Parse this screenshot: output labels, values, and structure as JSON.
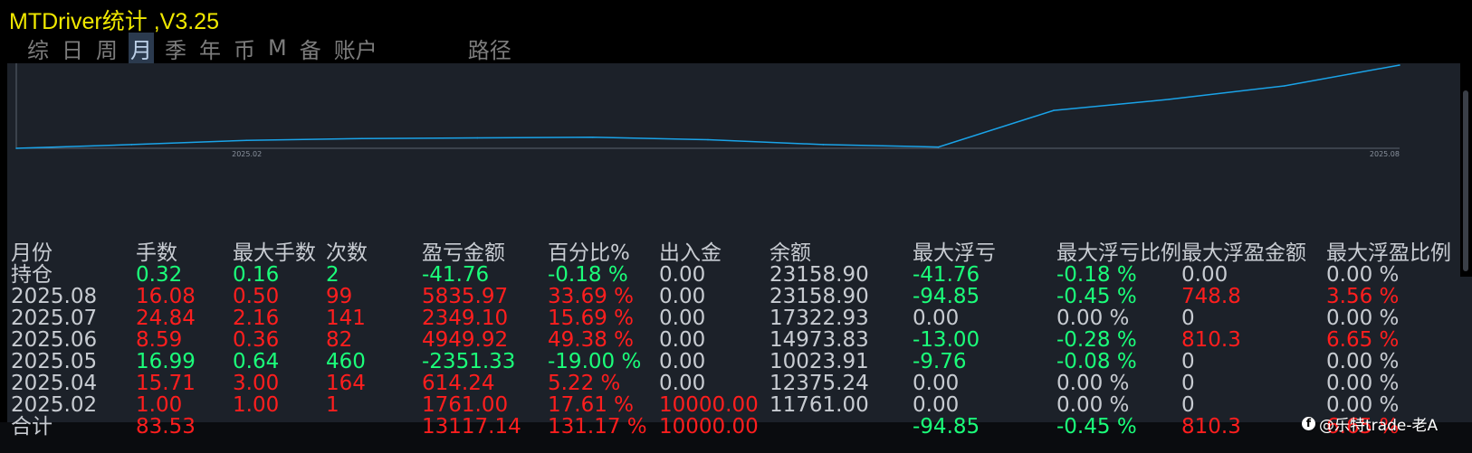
{
  "title": "MTDriver统计 ,V3.25",
  "tabs": [
    {
      "label": "综"
    },
    {
      "label": "日"
    },
    {
      "label": "周"
    },
    {
      "label": "月",
      "active": true
    },
    {
      "label": "季"
    },
    {
      "label": "年"
    },
    {
      "label": "币"
    },
    {
      "label": "M"
    },
    {
      "label": "备"
    },
    {
      "label": "账户"
    },
    {
      "label": "路径"
    }
  ],
  "chart_data": {
    "type": "line",
    "series": [
      {
        "values": [
          1000,
          1300,
          1650,
          1800,
          1850,
          1900,
          1700,
          1300,
          1100,
          4100,
          5000,
          6100,
          7800
        ]
      }
    ],
    "x_tick_labels": [
      "2025.02",
      "2025.08"
    ],
    "color": "#1aa3e8"
  },
  "table": {
    "headers": [
      "月份",
      "手数",
      "最大手数",
      "次数",
      "盈亏金额",
      "百分比%",
      "出入金",
      "余额",
      "最大浮亏",
      "最大浮亏比例",
      "最大浮盈金额",
      "最大浮盈比例"
    ],
    "rows": [
      {
        "cells": [
          "持仓",
          "0.32",
          "0.16",
          "2",
          "-41.76",
          "-0.18 %",
          "0.00",
          "23158.90",
          "-41.76",
          "-0.18 %",
          "0.00",
          "0.00 %"
        ],
        "colors": [
          "w",
          "g",
          "g",
          "g",
          "g",
          "g",
          "w",
          "w",
          "g",
          "g",
          "w",
          "w"
        ]
      },
      {
        "cells": [
          "2025.08",
          "16.08",
          "0.50",
          "99",
          "5835.97",
          "33.69 %",
          "0.00",
          "23158.90",
          "-94.85",
          "-0.45 %",
          "748.8",
          "3.56 %"
        ],
        "colors": [
          "w",
          "r",
          "r",
          "r",
          "r",
          "r",
          "w",
          "w",
          "g",
          "g",
          "r",
          "r"
        ]
      },
      {
        "cells": [
          "2025.07",
          "24.84",
          "2.16",
          "141",
          "2349.10",
          "15.69 %",
          "0.00",
          "17322.93",
          "0.00",
          "0.00 %",
          "0",
          "0.00 %"
        ],
        "colors": [
          "w",
          "r",
          "r",
          "r",
          "r",
          "r",
          "w",
          "w",
          "w",
          "w",
          "w",
          "w"
        ]
      },
      {
        "cells": [
          "2025.06",
          "8.59",
          "0.36",
          "82",
          "4949.92",
          "49.38 %",
          "0.00",
          "14973.83",
          "-13.00",
          "-0.28 %",
          "810.3",
          "6.65 %"
        ],
        "colors": [
          "w",
          "r",
          "r",
          "r",
          "r",
          "r",
          "w",
          "w",
          "g",
          "g",
          "r",
          "r"
        ]
      },
      {
        "cells": [
          "2025.05",
          "16.99",
          "0.64",
          "460",
          "-2351.33",
          "-19.00 %",
          "0.00",
          "10023.91",
          "-9.76",
          "-0.08 %",
          "0",
          "0.00 %"
        ],
        "colors": [
          "w",
          "g",
          "g",
          "g",
          "g",
          "g",
          "w",
          "w",
          "g",
          "g",
          "w",
          "w"
        ]
      },
      {
        "cells": [
          "2025.04",
          "15.71",
          "3.00",
          "164",
          "614.24",
          "5.22 %",
          "0.00",
          "12375.24",
          "0.00",
          "0.00 %",
          "0",
          "0.00 %"
        ],
        "colors": [
          "w",
          "r",
          "r",
          "r",
          "r",
          "r",
          "w",
          "w",
          "w",
          "w",
          "w",
          "w"
        ]
      },
      {
        "cells": [
          "2025.02",
          "1.00",
          "1.00",
          "1",
          "1761.00",
          "17.61 %",
          "10000.00",
          "11761.00",
          "0.00",
          "0.00 %",
          "0",
          "0.00 %"
        ],
        "colors": [
          "w",
          "r",
          "r",
          "r",
          "r",
          "r",
          "r",
          "w",
          "w",
          "w",
          "w",
          "w"
        ]
      },
      {
        "cells": [
          "合计",
          "83.53",
          "",
          "",
          "13117.14",
          "131.17 %",
          "10000.00",
          "",
          "-94.85",
          "-0.45 %",
          "810.3",
          "6.65 %"
        ],
        "colors": [
          "w",
          "r",
          "r",
          "r",
          "r",
          "r",
          "r",
          "w",
          "g",
          "g",
          "r",
          "r"
        ]
      }
    ]
  },
  "watermark": {
    "icon": "facebook-icon",
    "text": "@乐特trade-老A"
  },
  "colors": {
    "positive": "#ff1e1e",
    "negative": "#1bff7a",
    "neutral": "#c8ccd2",
    "title": "#f0e800"
  }
}
